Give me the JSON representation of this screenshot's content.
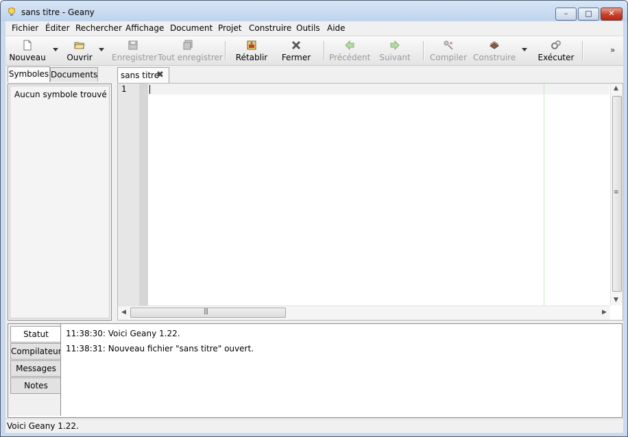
{
  "window": {
    "title": "sans titre - Geany",
    "app_icon": "geany-lamp-icon"
  },
  "title_buttons": {
    "minimize": "–",
    "maximize": "□",
    "close": "✕"
  },
  "menu": [
    "Fichier",
    "Éditer",
    "Rechercher",
    "Affichage",
    "Document",
    "Projet",
    "Construire",
    "Outils",
    "Aide"
  ],
  "toolbar": {
    "new": "Nouveau",
    "open": "Ouvrir",
    "save": "Enregistrer",
    "save_all": "Tout enregistrer",
    "revert": "Rétablir",
    "close": "Fermer",
    "back": "Précédent",
    "forward": "Suivant",
    "compile": "Compiler",
    "build": "Construire",
    "execute": "Exécuter",
    "overflow": "»"
  },
  "sidebar": {
    "tabs": [
      "Symboles",
      "Documents"
    ],
    "empty_message": "Aucun symbole trouvé"
  },
  "editor": {
    "tab_label": "sans titre",
    "line_numbers": [
      "1"
    ],
    "content": ""
  },
  "messages": {
    "tabs": [
      "Statut",
      "Compilateur",
      "Messages",
      "Notes"
    ],
    "lines": [
      "11:38:30: Voici Geany 1.22.",
      "11:38:31: Nouveau fichier \"sans titre\" ouvert."
    ]
  },
  "status_bar": {
    "text": "Voici Geany 1.22."
  },
  "colors": {
    "title_bar": "#c9daef",
    "close_button": "#c7402a",
    "long_line_marker": "#c8e6c8",
    "disabled_text": "#9a9a9a"
  }
}
